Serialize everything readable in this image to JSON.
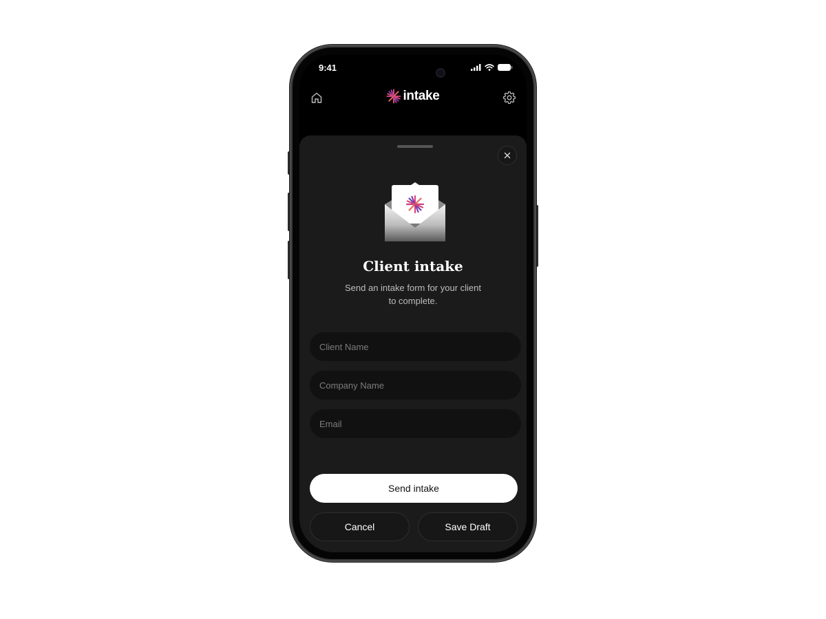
{
  "status_bar": {
    "time": "9:41",
    "icons": [
      "signal-icon",
      "wifi-icon",
      "battery-icon"
    ]
  },
  "header": {
    "brand": "intake",
    "home_icon": "home-icon",
    "settings_icon": "gear-icon"
  },
  "sheet": {
    "title": "Client intake",
    "subtitle": "Send an intake form for your client to complete.",
    "close_icon": "close-icon",
    "illustration": "envelope-icon",
    "fields": {
      "client_name": {
        "placeholder": "Client Name",
        "value": ""
      },
      "company_name": {
        "placeholder": "Company Name",
        "value": ""
      },
      "email": {
        "placeholder": "Email",
        "value": ""
      }
    },
    "actions": {
      "primary": "Send intake",
      "cancel": "Cancel",
      "save_draft": "Save Draft"
    }
  },
  "colors": {
    "background": "#ffffff",
    "screen": "#000000",
    "sheet": "#1b1b1b",
    "field": "#111111",
    "primary_button": "#ffffff",
    "logo_pink": "#e0457b",
    "logo_purple": "#6a3fb5"
  }
}
